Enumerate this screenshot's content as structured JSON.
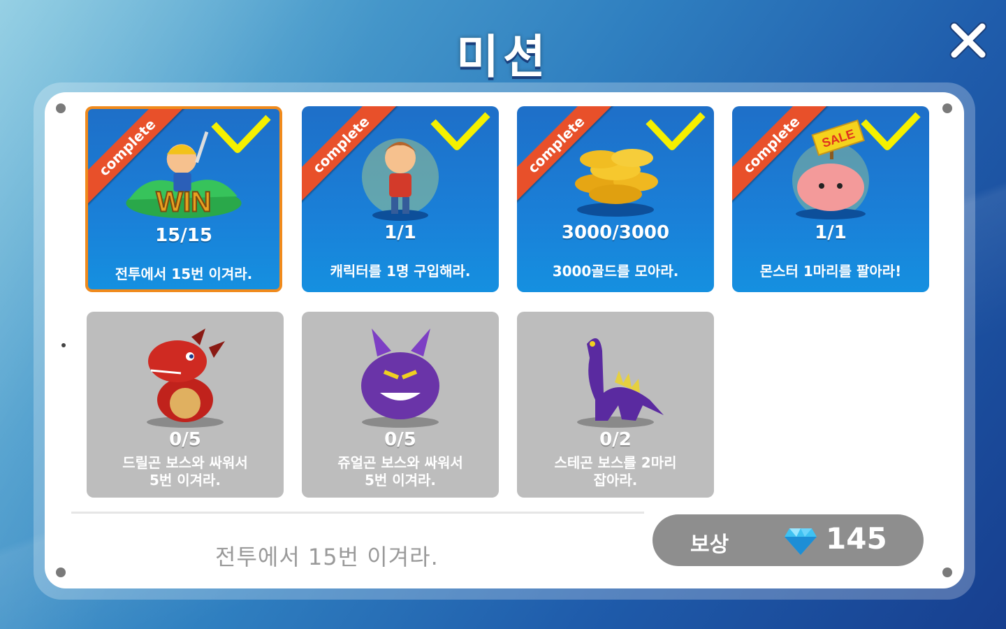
{
  "title": "미션",
  "missions": [
    {
      "state": "complete",
      "badge": "complete",
      "progress": "15/15",
      "desc": "전투에서 15번 이겨라.",
      "art": "win-icon",
      "art_text": "WIN"
    },
    {
      "state": "complete",
      "badge": "complete",
      "progress": "1/1",
      "desc": "캐릭터를 1명 구입해라.",
      "art": "hero-icon"
    },
    {
      "state": "complete",
      "badge": "complete",
      "progress": "3000/3000",
      "desc": "3000골드를 모아라.",
      "art": "gold-coins-icon"
    },
    {
      "state": "complete",
      "badge": "complete",
      "progress": "1/1",
      "desc": "몬스터 1마리를 팔아라!",
      "art": "pig-sale-icon",
      "art_text": "SALE"
    },
    {
      "state": "incomplete",
      "progress": "0/5",
      "desc": "드릴곤 보스와 싸워서\n5번 이겨라.",
      "art": "red-dragon-icon"
    },
    {
      "state": "incomplete",
      "progress": "0/5",
      "desc": "쥬얼곤 보스와 싸워서\n5번 이겨라.",
      "art": "purple-monster-icon"
    },
    {
      "state": "incomplete",
      "progress": "0/2",
      "desc": "스테곤 보스를 2마리\n잡아라.",
      "art": "purple-dinosaur-icon"
    }
  ],
  "footer": {
    "selected_desc": "전투에서 15번 이겨라.",
    "reward_label": "보상",
    "reward_value": "145",
    "reward_icon": "diamond-icon"
  },
  "colors": {
    "complete_card": "#1a80d8",
    "incomplete_card": "#bdbdbd",
    "ribbon": "#e8502a",
    "check": "#f5f000",
    "selected_border": "#f08a1c",
    "reward_bar": "#8e8e8e"
  }
}
